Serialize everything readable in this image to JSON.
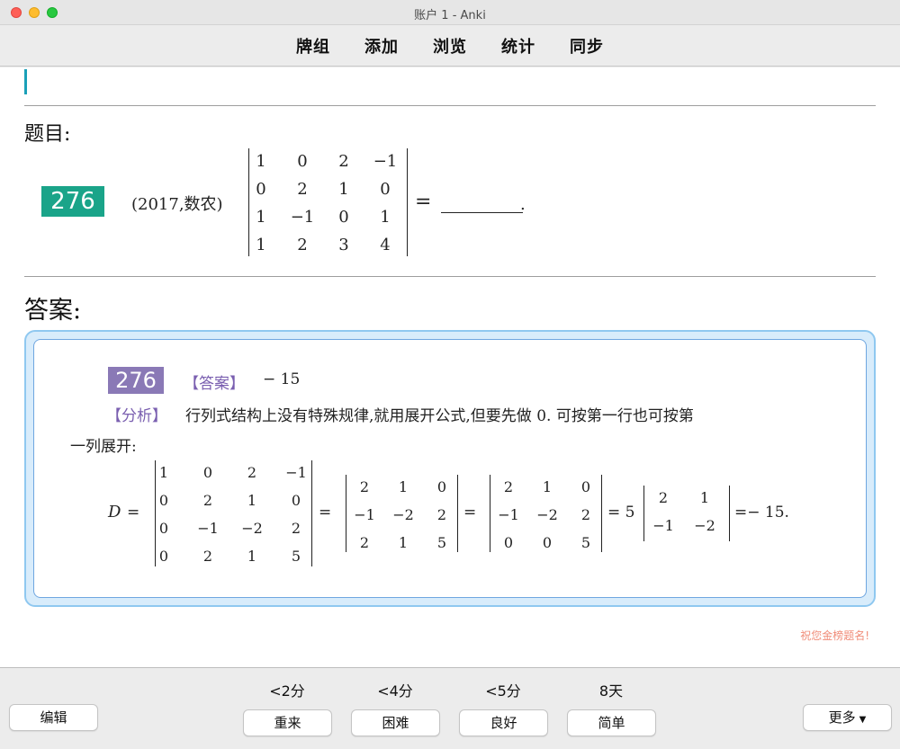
{
  "window": {
    "title": "账户 1 - Anki"
  },
  "toolbar": {
    "items": [
      "牌组",
      "添加",
      "浏览",
      "统计",
      "同步"
    ]
  },
  "question": {
    "label": "题目:",
    "number": "276",
    "source": "(2017,数农)",
    "matrix": [
      [
        "1",
        "0",
        "2",
        "−1"
      ],
      [
        "0",
        "2",
        "1",
        "0"
      ],
      [
        "1",
        "−1",
        "0",
        "1"
      ],
      [
        "1",
        "2",
        "3",
        "4"
      ]
    ],
    "equals": "=",
    "end_dot": "."
  },
  "answer": {
    "label": "答案:",
    "number": "276",
    "answer_tag": "【答案】",
    "answer_value": "− 15",
    "analysis_tag": "【分析】",
    "analysis_line1": "行列式结构上没有特殊规律,就用展开公式,但要先做 0. 可按第一行也可按第",
    "analysis_line2": "一列展开:",
    "d_symbol": "D",
    "m1": [
      [
        "1",
        "0",
        "2",
        "−1"
      ],
      [
        "0",
        "2",
        "1",
        "0"
      ],
      [
        "0",
        "−1",
        "−2",
        "2"
      ],
      [
        "0",
        "2",
        "1",
        "5"
      ]
    ],
    "m2": [
      [
        "2",
        "1",
        "0"
      ],
      [
        "−1",
        "−2",
        "2"
      ],
      [
        "2",
        "1",
        "5"
      ]
    ],
    "m3": [
      [
        "2",
        "1",
        "0"
      ],
      [
        "−1",
        "−2",
        "2"
      ],
      [
        "0",
        "0",
        "5"
      ]
    ],
    "m4": [
      [
        "2",
        "1"
      ],
      [
        "−1",
        "−2"
      ]
    ],
    "eq": "=",
    "eq5": "= 5",
    "result": "=− 15."
  },
  "footer_note": "祝您金榜题名!",
  "bottom": {
    "edit": "编辑",
    "more": "更多",
    "ratings": [
      {
        "interval": "<2分",
        "label": "重来"
      },
      {
        "interval": "<4分",
        "label": "困难"
      },
      {
        "interval": "<5分",
        "label": "良好"
      },
      {
        "interval": "8天",
        "label": "简单"
      }
    ]
  }
}
